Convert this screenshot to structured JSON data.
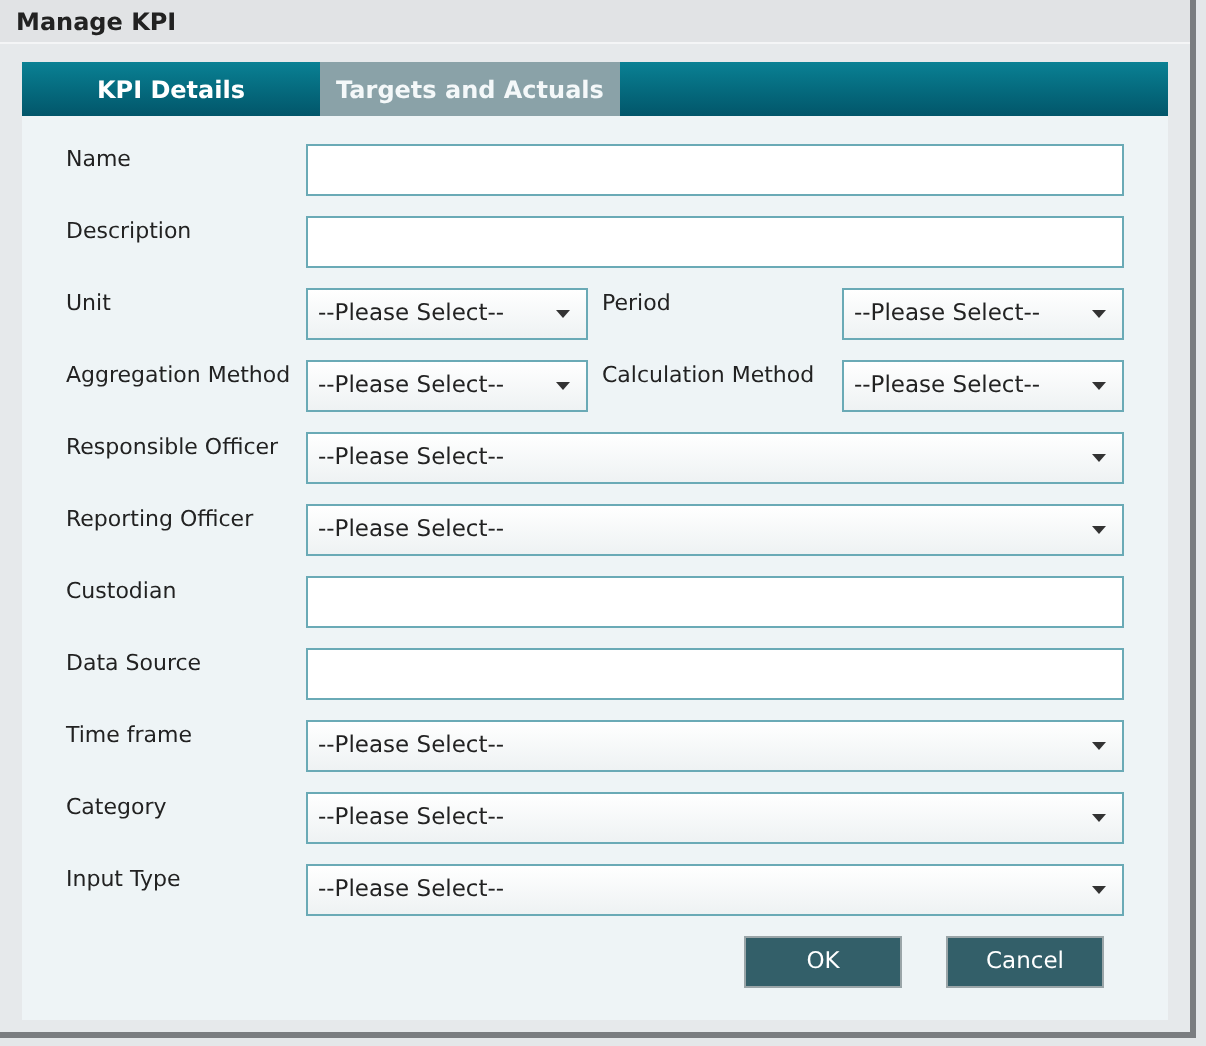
{
  "window": {
    "title": "Manage KPI"
  },
  "tabs": [
    {
      "label": "KPI Details",
      "selected": true
    },
    {
      "label": "Targets and Actuals",
      "selected": false
    }
  ],
  "fields": [
    {
      "kind": "text",
      "label": "Name"
    },
    {
      "kind": "text",
      "label": "Description"
    },
    {
      "kind": "pair",
      "items": [
        {
          "label": "Unit",
          "value": "--Please Select--"
        },
        {
          "label": "Period",
          "value": "--Please Select--"
        }
      ]
    },
    {
      "kind": "pair",
      "items": [
        {
          "label": "Aggregation Method",
          "value": "--Please Select--"
        },
        {
          "label": "Calculation Method",
          "value": "--Please Select--"
        }
      ]
    },
    {
      "kind": "select",
      "label": "Responsible Officer",
      "value": "--Please Select--"
    },
    {
      "kind": "select",
      "label": "Reporting Officer",
      "value": "--Please Select--"
    },
    {
      "kind": "text",
      "label": "Custodian"
    },
    {
      "kind": "text",
      "label": "Data Source"
    },
    {
      "kind": "select",
      "label": "Time frame",
      "value": "--Please Select--"
    },
    {
      "kind": "select",
      "label": "Category",
      "value": "--Please Select--"
    },
    {
      "kind": "select",
      "label": "Input Type",
      "value": "--Please Select--"
    }
  ],
  "buttons": [
    "OK",
    "Cancel"
  ]
}
